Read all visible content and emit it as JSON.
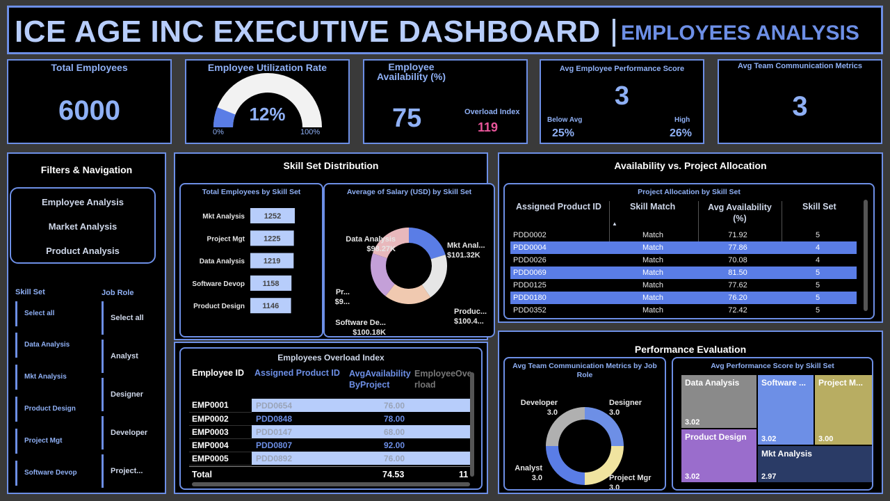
{
  "header": {
    "title": "ICE AGE INC EXECUTIVE DASHBOARD",
    "subtitle": "EMPLOYEES ANALYSIS"
  },
  "kpis": {
    "total_employees": {
      "label": "Total Employees",
      "value": "6000"
    },
    "utilization": {
      "label": "Employee Utilization Rate",
      "value": "12%",
      "min": "0%",
      "max": "100%",
      "fill_fraction": 0.12
    },
    "availability": {
      "label_line1": "Employee",
      "label_line2": "Availability (%)",
      "value": "75",
      "overload_label": "Overload Index",
      "overload_value": "119"
    },
    "performance": {
      "label": "Avg Employee Performance Score",
      "value": "3",
      "below_label": "Below Avg",
      "below_value": "25%",
      "high_label": "High",
      "high_value": "26%"
    },
    "communication": {
      "label": "Avg Team Communication Metrics",
      "value": "3"
    }
  },
  "filters": {
    "title": "Filters & Navigation",
    "nav": [
      "Employee Analysis",
      "Market Analysis",
      "Product Analysis"
    ],
    "skill_set_label": "Skill Set",
    "skill_set_items": [
      "Select all",
      "Data Analysis",
      "Mkt Analysis",
      "Product Design",
      "Project Mgt",
      "Software Devop"
    ],
    "job_role_label": "Job Role",
    "job_role_items": [
      "Select all",
      "Analyst",
      "Designer",
      "Developer",
      "Project..."
    ]
  },
  "skill_dist": {
    "title": "Skill Set Distribution",
    "bar_title": "Total Employees by Skill Set",
    "donut_title": "Average of Salary (USD) by Skill Set"
  },
  "chart_data": [
    {
      "type": "bar",
      "title": "Total Employees by Skill Set",
      "categories": [
        "Mkt Analysis",
        "Project Mgt",
        "Data Analysis",
        "Software Devop",
        "Product Design"
      ],
      "values": [
        1252,
        1225,
        1219,
        1158,
        1146
      ],
      "value_labels": [
        "1252",
        "1225",
        "1219",
        "1158",
        "1146"
      ],
      "color": "#b7cdfb"
    },
    {
      "type": "pie",
      "title": "Average of Salary (USD) by Skill Set",
      "labels": [
        "Mkt Anal...",
        "Produc...",
        "Software De...",
        "Pr...",
        "Data Analysis"
      ],
      "value_labels": [
        "$101.32K",
        "$100.4...",
        "$100.18K",
        "$9...",
        "$98.27K"
      ],
      "values": [
        101.32,
        100.4,
        100.18,
        99.0,
        98.27
      ],
      "colors": [
        "#5a7de6",
        "#e6e6e6",
        "#f0c9b0",
        "#c4a0d8",
        "#e8b8bc"
      ]
    },
    {
      "type": "pie",
      "title": "Avg Team Communication Metrics by Job Role",
      "labels": [
        "Designer",
        "Project Mgr",
        "Analyst",
        "Developer"
      ],
      "value_labels": [
        "3.0",
        "3.0",
        "3.0",
        "3.0"
      ],
      "values": [
        3.0,
        3.0,
        3.0,
        3.0
      ],
      "colors": [
        "#6d8fe6",
        "#f0e4a0",
        "#5a7de6",
        "#b0b0b0"
      ]
    },
    {
      "type": "heatmap",
      "title": "Avg Performance Score by Skill Set",
      "labels": [
        "Data Analysis",
        "Software ...",
        "Project M...",
        "Product Design",
        "Mkt Analysis"
      ],
      "values": [
        3.02,
        3.02,
        3.0,
        3.02,
        2.97
      ],
      "value_labels": [
        "3.02",
        "3.02",
        "3.00",
        "3.02",
        "2.97"
      ],
      "colors": [
        "#8a8a8a",
        "#6d8fe6",
        "#b8ad62",
        "#9a6dcc",
        "#2a3b66"
      ]
    }
  ],
  "allocation": {
    "title": "Availability vs. Project Allocation",
    "table_title": "Project Allocation by Skill Set",
    "headers": [
      "Assigned Product ID",
      "Skill Match",
      "Avg Availability (%)",
      "Skill Set"
    ],
    "rows": [
      {
        "id": "PDD0002",
        "match": "Match",
        "avail": "71.92",
        "skill": "5",
        "hl": false
      },
      {
        "id": "PDD0004",
        "match": "Match",
        "avail": "77.86",
        "skill": "4",
        "hl": true
      },
      {
        "id": "PDD0026",
        "match": "Match",
        "avail": "70.08",
        "skill": "4",
        "hl": false
      },
      {
        "id": "PDD0069",
        "match": "Match",
        "avail": "81.50",
        "skill": "5",
        "hl": true
      },
      {
        "id": "PDD0125",
        "match": "Match",
        "avail": "77.62",
        "skill": "5",
        "hl": false
      },
      {
        "id": "PDD0180",
        "match": "Match",
        "avail": "76.20",
        "skill": "5",
        "hl": true
      },
      {
        "id": "PDD0352",
        "match": "Match",
        "avail": "72.42",
        "skill": "5",
        "hl": false
      }
    ]
  },
  "overload": {
    "title": "Employees Overload Index",
    "headers": [
      "Employee ID",
      "Assigned Product ID",
      "AvgAvailabilityByProject",
      "EmployeeOverload"
    ],
    "rows": [
      {
        "emp": "EMP0001",
        "prod": "PDD0654",
        "avail": "76.00",
        "dark": false
      },
      {
        "emp": "EMP0002",
        "prod": "PDD0848",
        "avail": "78.00",
        "dark": true
      },
      {
        "emp": "EMP0003",
        "prod": "PDD0147",
        "avail": "68.00",
        "dark": false
      },
      {
        "emp": "EMP0004",
        "prod": "PDD0807",
        "avail": "92.00",
        "dark": true
      },
      {
        "emp": "EMP0005",
        "prod": "PDD0892",
        "avail": "76.00",
        "dark": false
      }
    ],
    "total_label": "Total",
    "total_avail": "74.53",
    "total_overload": "11"
  },
  "performance_eval": {
    "title": "Performance Evaluation",
    "comm_title": "Avg Team Communication Metrics by Job Role",
    "score_title": "Avg Performance Score by Skill Set"
  }
}
